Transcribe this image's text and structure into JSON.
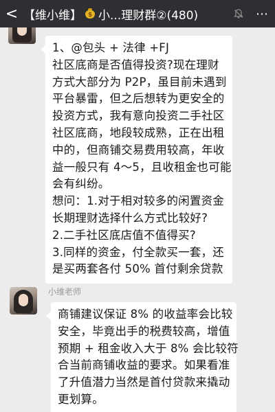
{
  "topbar": {
    "back_glyph": "<",
    "title_prefix": "【维小维】",
    "title_suffix": "小...理财群②(480)",
    "bag_icon": "money-bag-icon",
    "mute_icon": "mute-bell-icon",
    "menu_glyph": "⋯"
  },
  "messages": [
    {
      "sender": "",
      "lines": [
        "1、@包头 + 法律 +FJ",
        "社区底商是否值得投资?现在理财",
        "方式大部分为 P2P，虽目前未遇到",
        "平台暴雷，但之后想转为更安全的",
        "投资方式，我有意向投资二手社区",
        "社区底商，地段较成熟，正在出租",
        "中的，但商铺交易费用较高，年收",
        "益一般只有 4～5，且收租金也可能",
        "会有纠纷。",
        "想问：1.对于相对较多的闲置资金",
        "长期理财选择什么方式比较好?",
        "2.二手社区底店值不值得买?",
        "3.同样的资金，付全款买一套，还",
        "是买两套各付 50% 首付剩余贷款"
      ]
    },
    {
      "sender": "小维老师",
      "lines": [
        "商铺建议保证 8% 的收益率会比较",
        "安全，毕竟出手的税费较高，增值",
        "预期 + 租金收入大于 8% 会比较符",
        "合当前商铺收益的要求。如果看准",
        "了升值潜力当然是首付贷款来撬动",
        "更划算。"
      ]
    }
  ],
  "colors": {
    "topbar_bg": "#2f2f33",
    "chat_bg": "#ececec",
    "bubble_bg": "#ffffff",
    "sender_text": "#9a9a9a"
  }
}
